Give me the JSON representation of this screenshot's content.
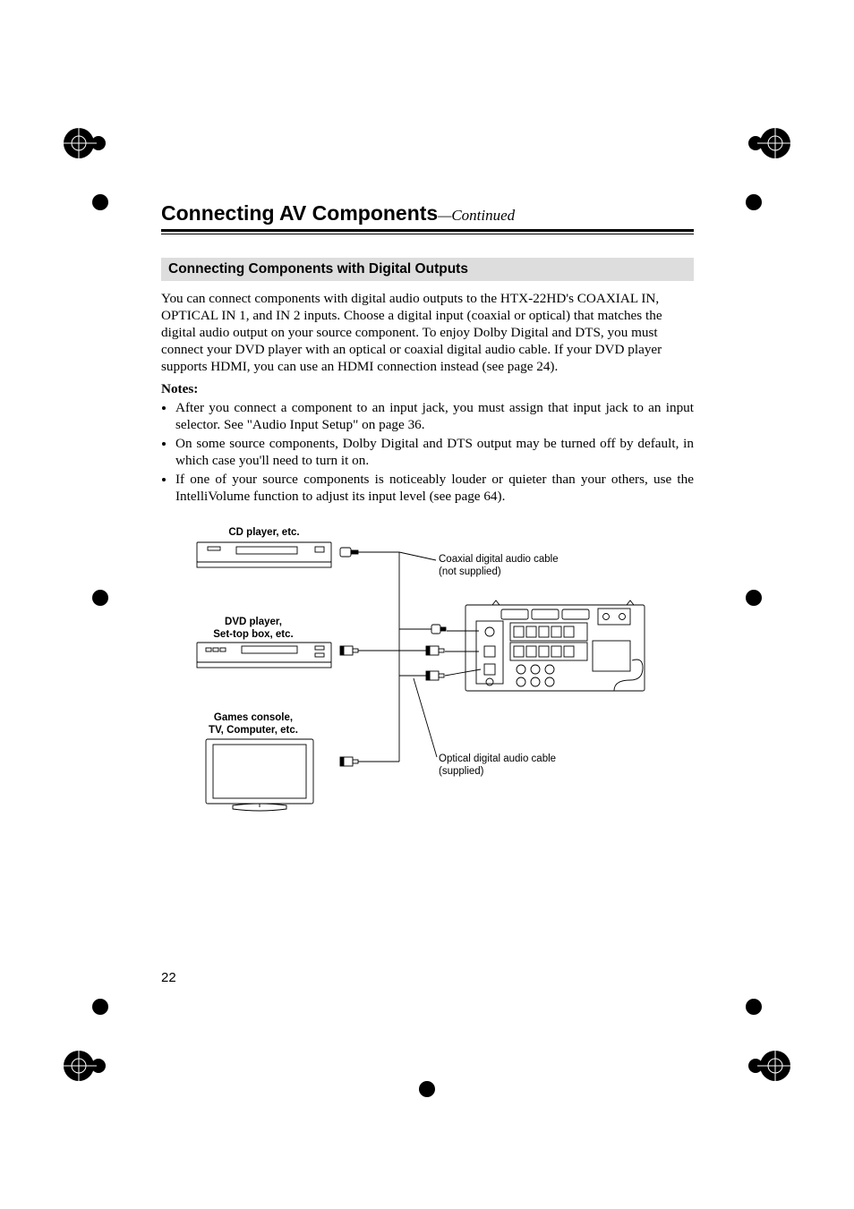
{
  "chapter_title": "Connecting AV Components",
  "chapter_suffix": "—Continued",
  "section_title": "Connecting Components with Digital Outputs",
  "intro_para": "You can connect components with digital audio outputs to the HTX-22HD's COAXIAL IN, OPTICAL IN 1, and IN 2 inputs. Choose a digital input (coaxial or optical) that matches the digital audio output on your source component. To enjoy Dolby Digital and DTS, you must connect your DVD player with an optical or coaxial digital audio cable. If your DVD player supports HDMI, you can use an HDMI connection instead (see page 24).",
  "notes_label": "Notes:",
  "notes": [
    "After you connect a component to an input jack, you must assign that input jack to an input selector. See \"Audio Input Setup\" on page 36.",
    "On some source components, Dolby Digital and DTS output may be turned off by default, in which case you'll need to turn it on.",
    "If one of your source components is noticeably louder or quieter than your others, use the IntelliVolume function to adjust its input level (see page 64)."
  ],
  "page_number": "22",
  "diagram": {
    "device1_label": "CD player, etc.",
    "device2_label_1": "DVD player,",
    "device2_label_2": "Set-top box, etc.",
    "device3_label_1": "Games console,",
    "device3_label_2": "TV, Computer, etc.",
    "cable_coax_1": "Coaxial digital audio cable",
    "cable_coax_2": "(not supplied)",
    "cable_opt_1": "Optical digital audio cable",
    "cable_opt_2": "(supplied)"
  }
}
